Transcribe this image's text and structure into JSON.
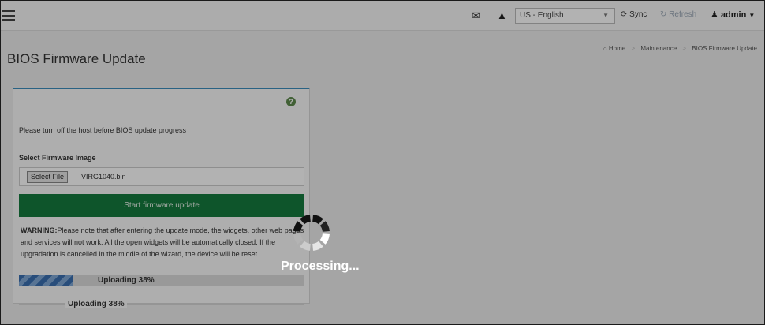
{
  "header": {
    "menu_icon": "hamburger-icon",
    "mail_icon": "envelope-icon",
    "alert_icon": "warning-icon",
    "language_selected": "US - English",
    "sync_label": "Sync",
    "refresh_label": "Refresh",
    "user_label": "admin",
    "icons": {
      "sync": "sync-icon",
      "refresh": "refresh-icon",
      "user": "user-icon"
    }
  },
  "page": {
    "title": "BIOS Firmware Update",
    "breadcrumb": {
      "home": "Home",
      "section": "Maintenance",
      "current": "BIOS Firmware Update"
    }
  },
  "panel": {
    "help_icon": "question-circle-icon",
    "notice": "Please turn off the host before BIOS update progress",
    "select_label": "Select Firmware Image",
    "file_button": "Select File",
    "file_name": "VIRG1040.bin",
    "start_button": "Start firmware update",
    "warning_prefix": "WARNING:",
    "warning_text": "Please note that after entering the update mode, the widgets, other web pages and services will not work. All the open widgets will be automatically closed. If the upgradation is cancelled in the middle of the wizard, the device will be reset.",
    "progress": {
      "value": 0.19,
      "label": "Uploading 38%"
    },
    "status_text": "Uploading 38%"
  },
  "overlay": {
    "spinner_icon": "loading-spinner-icon",
    "message": "Processing..."
  },
  "colors": {
    "primary_button": "#157a3e",
    "panel_accent": "#3c8dbc",
    "progress_bar": "#3a6fb0",
    "help_icon": "#5e8a4c"
  }
}
